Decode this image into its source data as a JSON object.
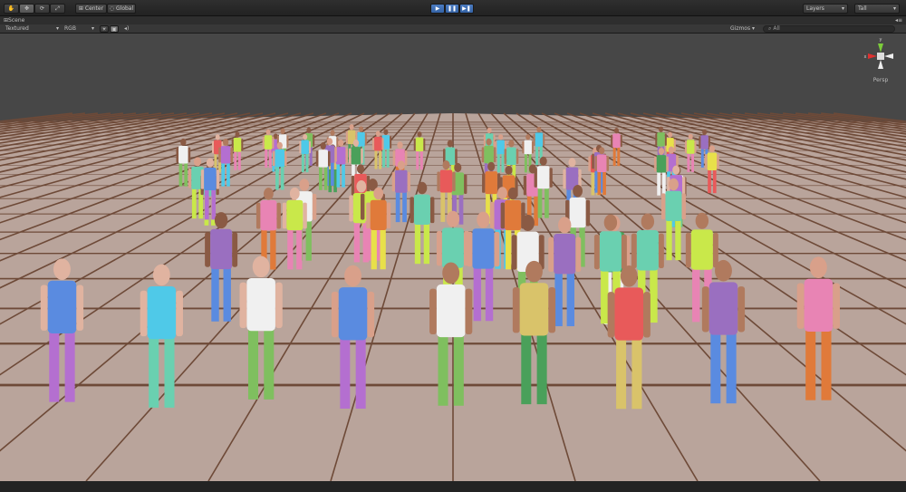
{
  "toolbar": {
    "tools": [
      "hand-tool",
      "move-tool",
      "rotate-tool",
      "scale-tool"
    ],
    "pivot_label": "Center",
    "space_label": "Global",
    "play_controls": [
      "play",
      "pause",
      "step"
    ],
    "layers_label": "Layers",
    "layout_label": "Tall"
  },
  "scene_tab": {
    "label": "Scene"
  },
  "scene_controls": {
    "render_mode": "Textured",
    "color_mode": "RGB",
    "gizmos_label": "Gizmos",
    "search_placeholder": "All"
  },
  "gizmo": {
    "y_label": "y",
    "x_label": "x",
    "projection_label": "Persp"
  },
  "colors": {
    "floor": "#b9a49b",
    "grid_line": "#6e4a38",
    "sky": "#474747",
    "accent": "#3d6fb6"
  },
  "figure_colors": [
    "#7fbf5f",
    "#e8e04a",
    "#4fc9e8",
    "#f0f0f0",
    "#e07a3a",
    "#b46fd0",
    "#4aa05a",
    "#e884b4",
    "#5a8be0",
    "#d9c36a",
    "#c9e84a",
    "#9a6fc0",
    "#e85a5a",
    "#6ad0b0"
  ]
}
